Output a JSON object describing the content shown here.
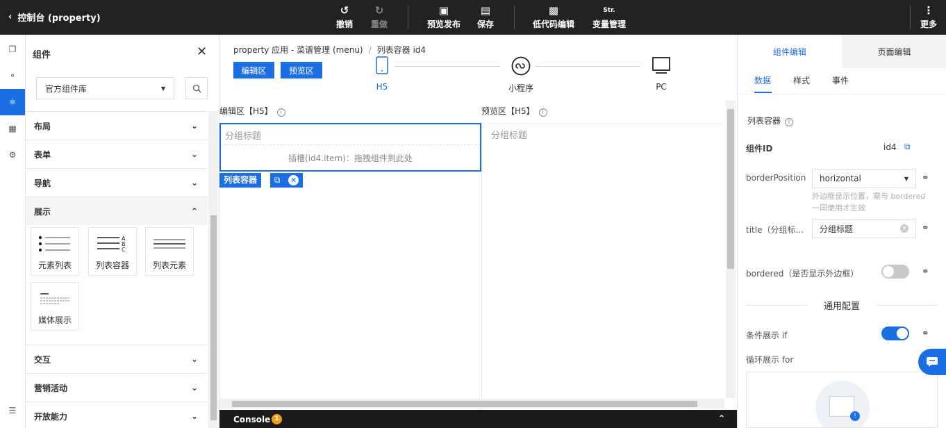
{
  "topbar": {
    "title": "控制台 (property)",
    "tools": {
      "undo": "撤销",
      "redo": "重做",
      "preview_publish": "预览发布",
      "save": "保存",
      "lowcode": "低代码编辑",
      "variables": "变量管理",
      "variables_icon_text": "Str.",
      "more": "更多"
    }
  },
  "panel": {
    "title": "组件",
    "library_select": "官方组件库",
    "sections": {
      "layout": "布局",
      "form": "表单",
      "nav": "导航",
      "display": "展示",
      "interaction": "交互",
      "marketing": "营销活动",
      "open": "开放能力"
    },
    "tiles": {
      "element_list": "元素列表",
      "list_container": "列表容器",
      "list_element": "列表元素",
      "media_display": "媒体展示"
    },
    "list_icon_letters": [
      "A",
      "B",
      "C"
    ]
  },
  "canvas": {
    "breadcrumb_app": "property 应用 - 菜谱管理 (menu)",
    "breadcrumb_sep": "/",
    "breadcrumb_current": "列表容器 id4",
    "edit_btn": "编辑区",
    "preview_btn": "预览区",
    "devices": {
      "h5": "H5",
      "mini": "小程序",
      "pc": "PC"
    },
    "edit_zone_title": "编辑区【H5】",
    "preview_zone_title": "预览区【H5】",
    "edit_subtitle": "分组标题",
    "slot_text": "插槽(id4.item)：拖拽组件到此处",
    "preview_subtitle": "分组标题",
    "selected_tag": "列表容器",
    "console_label": "Console",
    "console_badge": "1"
  },
  "right": {
    "tab_component": "组件编辑",
    "tab_page": "页面编辑",
    "subtabs": {
      "data": "数据",
      "style": "样式",
      "event": "事件"
    },
    "section_title": "列表容器",
    "id_label": "组件ID",
    "id_value": "id4",
    "border_position_label": "borderPosition",
    "border_position_value": "horizontal",
    "border_position_hint": "外边框显示位置，需与 bordered 一同使用才生效",
    "title_label": "title（分组标...",
    "title_value": "分组标题",
    "bordered_label": "bordered（是否显示外边框）",
    "bordered_on": false,
    "common_config": "通用配置",
    "if_label": "条件展示 if",
    "if_on": true,
    "for_label": "循环展示 for"
  },
  "colors": {
    "accent": "#1c6fe3",
    "topbar": "#222222"
  }
}
